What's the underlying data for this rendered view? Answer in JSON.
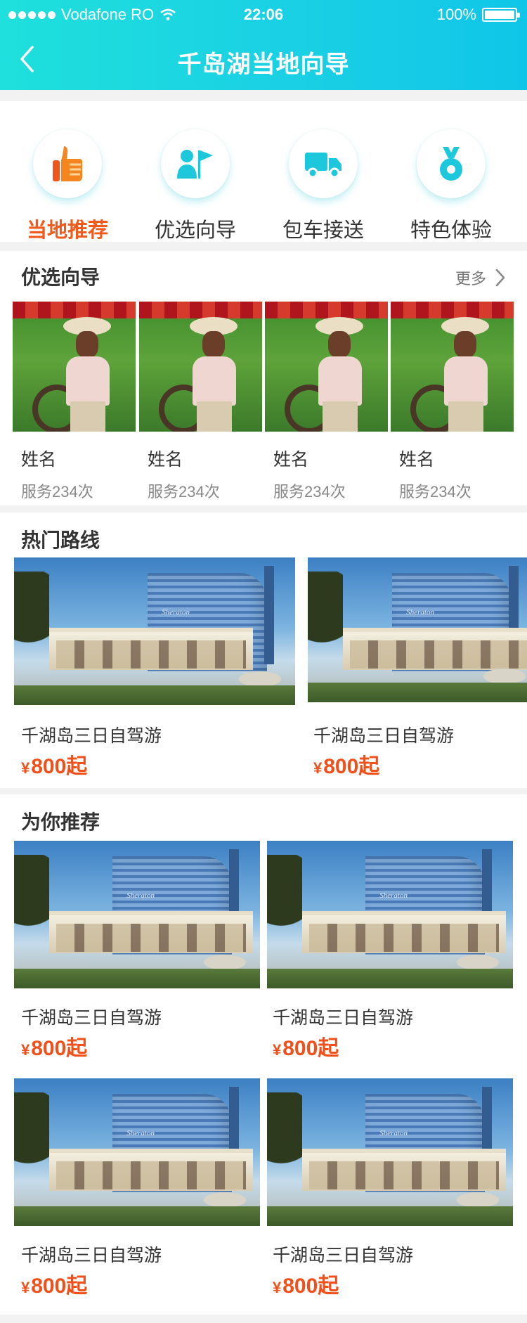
{
  "status_bar": {
    "carrier": "Vodafone RO",
    "time": "22:06",
    "battery": "100%"
  },
  "nav": {
    "title": "千岛湖当地向导",
    "back_icon": "chevron-left-icon"
  },
  "categories": [
    {
      "label": "当地推荐",
      "icon": "thumbs-up-icon",
      "active": true
    },
    {
      "label": "优选向导",
      "icon": "guide-flag-icon",
      "active": false
    },
    {
      "label": "包车接送",
      "icon": "van-icon",
      "active": false
    },
    {
      "label": "特色体验",
      "icon": "medal-icon",
      "active": false
    }
  ],
  "guides_section": {
    "title": "优选向导",
    "more": "更多",
    "items": [
      {
        "name": "姓名",
        "count": "服务234次"
      },
      {
        "name": "姓名",
        "count": "服务234次"
      },
      {
        "name": "姓名",
        "count": "服务234次"
      },
      {
        "name": "姓名",
        "count": "服务234次"
      }
    ]
  },
  "hot_routes": {
    "title": "热门路线",
    "items": [
      {
        "title": "千湖岛三日自驾游",
        "currency": "¥",
        "price": "800起",
        "image_sign": "Sheraton"
      },
      {
        "title": "千湖岛三日自驾游",
        "currency": "¥",
        "price": "800起",
        "image_sign": "Sheraton"
      }
    ]
  },
  "recommend": {
    "title": "为你推荐",
    "items": [
      {
        "title": "千湖岛三日自驾游",
        "currency": "¥",
        "price": "800起",
        "image_sign": "Sheraton"
      },
      {
        "title": "千湖岛三日自驾游",
        "currency": "¥",
        "price": "800起",
        "image_sign": "Sheraton"
      },
      {
        "title": "千湖岛三日自驾游",
        "currency": "¥",
        "price": "800起",
        "image_sign": "Sheraton"
      },
      {
        "title": "千湖岛三日自驾游",
        "currency": "¥",
        "price": "800起",
        "image_sign": "Sheraton"
      }
    ]
  },
  "colors": {
    "header_gradient_start": "#1fe0dc",
    "header_gradient_end": "#10c6e8",
    "accent": "#f25a1c",
    "price": "#f2501a",
    "icon_teal": "#1ec8dc",
    "icon_orange": "#f5861f"
  }
}
